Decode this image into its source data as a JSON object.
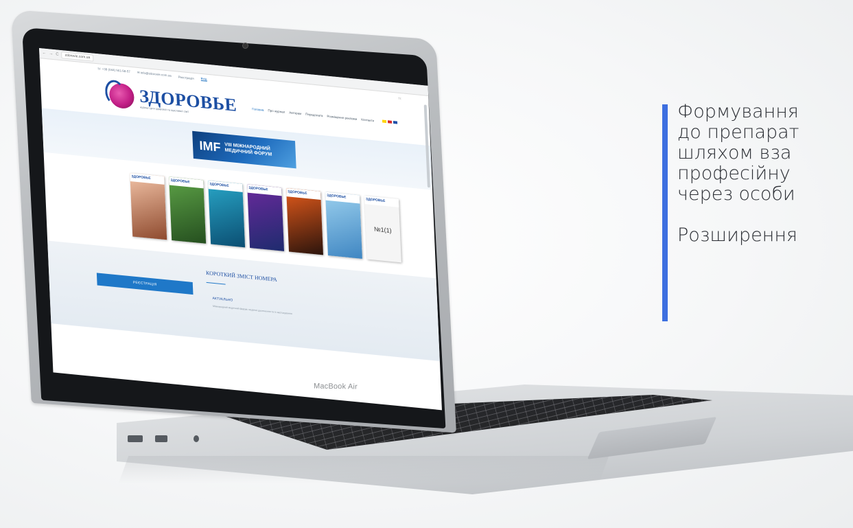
{
  "browser": {
    "url": "zdorovie.com.ua",
    "nav_back": "←",
    "nav_forward": "→",
    "nav_reload": "C"
  },
  "site": {
    "topbar": {
      "phone": "☏ +38 (044) 561-58-57",
      "email": "✉ info@zdorovie.com.ua",
      "register": "Реєстрація",
      "login": "Вхід",
      "social": "f  t"
    },
    "logo": {
      "title": "ЗДОРОВЬЕ",
      "subtitle": "журнал для здорової та щасливої сім'ї"
    },
    "nav": [
      {
        "label": "Головна",
        "active": true
      },
      {
        "label": "Про журнал",
        "active": false
      },
      {
        "label": "Авторам",
        "active": false
      },
      {
        "label": "Передплата",
        "active": false
      },
      {
        "label": "Розміщення реклами",
        "active": false
      },
      {
        "label": "Контакти",
        "active": false
      }
    ],
    "flags": [
      "#ffd500",
      "#d62b2b",
      "#1f4fa8"
    ],
    "banner": {
      "logo": "IMF",
      "line1": "VIII МІЖНАРОДНИЙ",
      "line2": "МЕДИЧНИЙ ФОРУМ"
    },
    "magazines": [
      {
        "masthead": "ЗДОРОВЬЕ",
        "colors": [
          "#f3c4a8",
          "#8e4a2e"
        ]
      },
      {
        "masthead": "ЗДОРОВЬЕ",
        "colors": [
          "#5da247",
          "#254f1f"
        ]
      },
      {
        "masthead": "ЗДОРОВЬЕ",
        "colors": [
          "#29a7c8",
          "#0b4e72"
        ]
      },
      {
        "masthead": "ЗДОРОВЬЕ",
        "colors": [
          "#6a2a9c",
          "#1e2b6e"
        ]
      },
      {
        "masthead": "ЗДОРОВЬЕ",
        "colors": [
          "#e35a1b",
          "#2b140c"
        ]
      },
      {
        "masthead": "ЗДОРОВЬЕ",
        "colors": [
          "#9bd0ee",
          "#3f86c2"
        ]
      },
      {
        "masthead": "ЗДОРОВЬЕ",
        "issue": "№1(1)",
        "colors": [
          "#f5f5f5",
          "#dddddd"
        ]
      }
    ],
    "register_button": "РЕЄСТРАЦІЯ",
    "short_title": "КОРОТКИЙ ЗМІСТ НОМЕРА",
    "actual": "АКТУАЛЬНО",
    "actual_line": "Міжнародний медичний форум: медичні досягнення та їх застосування"
  },
  "laptop": {
    "model": "MacBook Air"
  },
  "quote": {
    "accent": "#3d6fe0",
    "lines": [
      "Формування",
      "до препарат",
      "шляхом вза",
      "професійну",
      "через особи"
    ],
    "second": "Розширення"
  }
}
